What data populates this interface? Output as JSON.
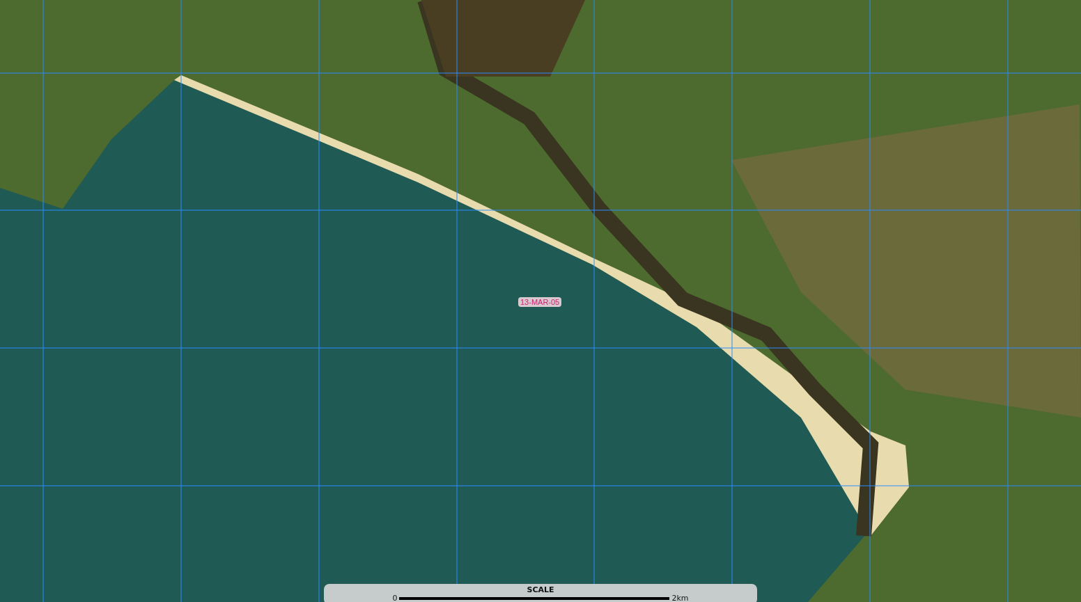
{
  "map": {
    "date_label": "13-MAR-05"
  },
  "scale_bar": {
    "title": "SCALE",
    "start": "0",
    "end": "2km"
  }
}
